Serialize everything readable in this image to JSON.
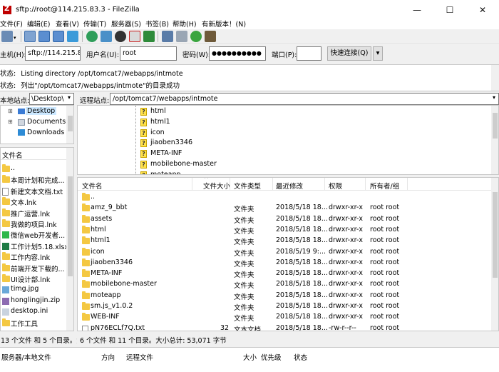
{
  "window": {
    "title": "sftp://root@114.215.83.3 - FileZilla",
    "controls": {
      "minimize": "—",
      "maximize": "☐",
      "close": "✕"
    }
  },
  "menu": [
    "文件(F)",
    "编辑(E)",
    "查看(V)",
    "传输(T)",
    "服务器(S)",
    "书签(B)",
    "帮助(H)",
    "有新版本！(N)"
  ],
  "quickconnect": {
    "host_label": "主机(H):",
    "host_value": "sftp://114.215.83.",
    "user_label": "用户名(U):",
    "user_value": "root",
    "pass_label": "密码(W):",
    "pass_value": "●●●●●●●●●●",
    "port_label": "端口(P):",
    "port_value": "",
    "connect_label": "快速连接(Q)",
    "dropdown": "▾"
  },
  "log": [
    {
      "prefix": "状态:",
      "text": "Listing directory /opt/tomcat7/webapps/intmote"
    },
    {
      "prefix": "状态:",
      "text": "列出\"/opt/tomcat7/webapps/intmote\"的目录成功"
    }
  ],
  "local": {
    "site_label": "本地站点:",
    "site_path": "\\Desktop\\",
    "tree": [
      {
        "label": "Desktop",
        "selected": true,
        "type": "desktop"
      },
      {
        "label": "Documents",
        "selected": false,
        "type": "docs"
      },
      {
        "label": "Downloads",
        "selected": false,
        "type": "download"
      }
    ],
    "column_name": "文件名",
    "files": [
      {
        "name": "..",
        "icon": "folder"
      },
      {
        "name": "本周计划和完成...",
        "icon": "folder"
      },
      {
        "name": "新建文本文档.txt",
        "icon": "file"
      },
      {
        "name": "文本.lnk",
        "icon": "folder"
      },
      {
        "name": "推广运营.lnk",
        "icon": "folder"
      },
      {
        "name": "我做的项目.lnk",
        "icon": "folder"
      },
      {
        "name": "微信web开发者...",
        "icon": "wechat"
      },
      {
        "name": "工作计划5.18.xlsx",
        "icon": "excel"
      },
      {
        "name": "工作内容.lnk",
        "icon": "folder"
      },
      {
        "name": "前端开发下载的...",
        "icon": "folder"
      },
      {
        "name": "UI设计部.lnk",
        "icon": "folder"
      },
      {
        "name": "timg.jpg",
        "icon": "image"
      },
      {
        "name": "honglingjin.zip",
        "icon": "zip"
      },
      {
        "name": "desktop.ini",
        "icon": "ini"
      },
      {
        "name": "工作工具",
        "icon": "folder"
      }
    ],
    "status": "13 个文件 和 5 个目录。大"
  },
  "remote": {
    "site_label": "远程站点:",
    "site_path": "/opt/tomcat7/webapps/intmote",
    "tree": [
      "html",
      "html1",
      "icon",
      "jiaoben3346",
      "META-INF",
      "mobilebone-master",
      "moteapp"
    ],
    "columns": {
      "name": "文件名",
      "size": "文件大小",
      "type": "文件类型",
      "modified": "最近修改",
      "perms": "权限",
      "owner": "所有者/组"
    },
    "sort_arrow": "^",
    "files": [
      {
        "name": "..",
        "size": "",
        "type": "",
        "modified": "",
        "perms": "",
        "owner": "",
        "icon": "folder"
      },
      {
        "name": "amz_9_bbt",
        "size": "",
        "type": "文件夹",
        "modified": "2018/5/18 18...",
        "perms": "drwxr-xr-x",
        "owner": "root root",
        "icon": "folder"
      },
      {
        "name": "assets",
        "size": "",
        "type": "文件夹",
        "modified": "2018/5/18 18...",
        "perms": "drwxr-xr-x",
        "owner": "root root",
        "icon": "folder"
      },
      {
        "name": "html",
        "size": "",
        "type": "文件夹",
        "modified": "2018/5/18 18...",
        "perms": "drwxr-xr-x",
        "owner": "root root",
        "icon": "folder"
      },
      {
        "name": "html1",
        "size": "",
        "type": "文件夹",
        "modified": "2018/5/18 18...",
        "perms": "drwxr-xr-x",
        "owner": "root root",
        "icon": "folder"
      },
      {
        "name": "icon",
        "size": "",
        "type": "文件夹",
        "modified": "2018/5/19 9:...",
        "perms": "drwxr-xr-x",
        "owner": "root root",
        "icon": "folder"
      },
      {
        "name": "jiaoben3346",
        "size": "",
        "type": "文件夹",
        "modified": "2018/5/18 18...",
        "perms": "drwxr-xr-x",
        "owner": "root root",
        "icon": "folder"
      },
      {
        "name": "META-INF",
        "size": "",
        "type": "文件夹",
        "modified": "2018/5/18 18...",
        "perms": "drwxr-xr-x",
        "owner": "root root",
        "icon": "folder"
      },
      {
        "name": "mobilebone-master",
        "size": "",
        "type": "文件夹",
        "modified": "2018/5/18 18...",
        "perms": "drwxr-xr-x",
        "owner": "root root",
        "icon": "folder"
      },
      {
        "name": "moteapp",
        "size": "",
        "type": "文件夹",
        "modified": "2018/5/18 18...",
        "perms": "drwxr-xr-x",
        "owner": "root root",
        "icon": "folder"
      },
      {
        "name": "sm.js_v1.0.2",
        "size": "",
        "type": "文件夹",
        "modified": "2018/5/18 18...",
        "perms": "drwxr-xr-x",
        "owner": "root root",
        "icon": "folder"
      },
      {
        "name": "WEB-INF",
        "size": "",
        "type": "文件夹",
        "modified": "2018/5/18 18...",
        "perms": "drwxr-xr-x",
        "owner": "root root",
        "icon": "folder"
      },
      {
        "name": "pN76ECLf7Q.txt",
        "size": "32",
        "type": "文本文档",
        "modified": "2018/5/18 18...",
        "perms": "-rw-r--r--",
        "owner": "root root",
        "icon": "file"
      }
    ],
    "status": "6 个文件 和 11 个目录。大小总计: 53,071 字节"
  },
  "queue": {
    "col_server": "服务器/本地文件",
    "col_direction": "方向",
    "col_remote": "远程文件",
    "col_size": "大小",
    "col_priority": "优先级",
    "col_status": "状态"
  }
}
